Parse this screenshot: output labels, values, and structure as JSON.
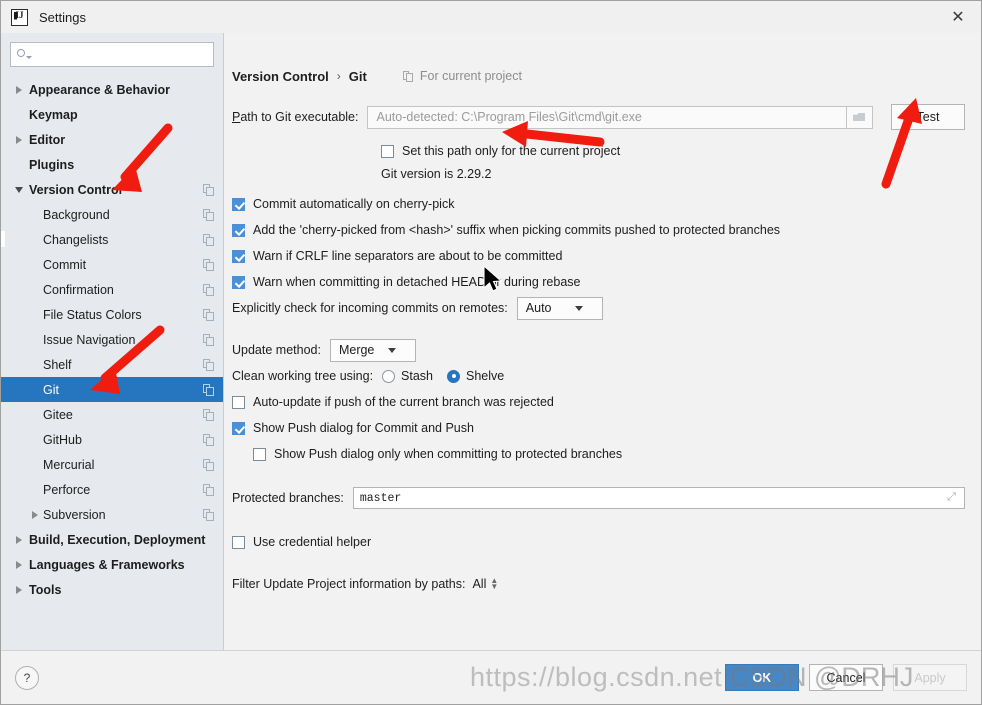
{
  "window": {
    "title": "Settings",
    "app_icon": "intellij-idea-icon",
    "close_icon": "✕"
  },
  "sidebar": {
    "search": {
      "placeholder": "",
      "value": "",
      "icon": "search-icon"
    },
    "items": [
      {
        "label": "Appearance & Behavior",
        "level": 0,
        "arrow": "right",
        "bold": true,
        "copy": false,
        "selected": false
      },
      {
        "label": "Keymap",
        "level": 0,
        "arrow": "none",
        "bold": true,
        "copy": false,
        "selected": false
      },
      {
        "label": "Editor",
        "level": 0,
        "arrow": "right",
        "bold": true,
        "copy": false,
        "selected": false
      },
      {
        "label": "Plugins",
        "level": 0,
        "arrow": "none",
        "bold": true,
        "copy": false,
        "selected": false
      },
      {
        "label": "Version Control",
        "level": 0,
        "arrow": "down",
        "bold": true,
        "copy": true,
        "selected": false
      },
      {
        "label": "Background",
        "level": 1,
        "arrow": "none",
        "bold": false,
        "copy": true,
        "selected": false
      },
      {
        "label": "Changelists",
        "level": 1,
        "arrow": "none",
        "bold": false,
        "copy": true,
        "selected": false
      },
      {
        "label": "Commit",
        "level": 1,
        "arrow": "none",
        "bold": false,
        "copy": true,
        "selected": false
      },
      {
        "label": "Confirmation",
        "level": 1,
        "arrow": "none",
        "bold": false,
        "copy": true,
        "selected": false
      },
      {
        "label": "File Status Colors",
        "level": 1,
        "arrow": "none",
        "bold": false,
        "copy": true,
        "selected": false
      },
      {
        "label": "Issue Navigation",
        "level": 1,
        "arrow": "none",
        "bold": false,
        "copy": true,
        "selected": false
      },
      {
        "label": "Shelf",
        "level": 1,
        "arrow": "none",
        "bold": false,
        "copy": true,
        "selected": false
      },
      {
        "label": "Git",
        "level": 1,
        "arrow": "none",
        "bold": false,
        "copy": true,
        "selected": true
      },
      {
        "label": "Gitee",
        "level": 1,
        "arrow": "none",
        "bold": false,
        "copy": true,
        "selected": false
      },
      {
        "label": "GitHub",
        "level": 1,
        "arrow": "none",
        "bold": false,
        "copy": true,
        "selected": false
      },
      {
        "label": "Mercurial",
        "level": 1,
        "arrow": "none",
        "bold": false,
        "copy": true,
        "selected": false
      },
      {
        "label": "Perforce",
        "level": 1,
        "arrow": "none",
        "bold": false,
        "copy": true,
        "selected": false
      },
      {
        "label": "Subversion",
        "level": 1,
        "arrow": "right",
        "bold": false,
        "copy": true,
        "selected": false
      },
      {
        "label": "Build, Execution, Deployment",
        "level": 0,
        "arrow": "right",
        "bold": true,
        "copy": false,
        "selected": false
      },
      {
        "label": "Languages & Frameworks",
        "level": 0,
        "arrow": "right",
        "bold": true,
        "copy": false,
        "selected": false
      },
      {
        "label": "Tools",
        "level": 0,
        "arrow": "right",
        "bold": true,
        "copy": false,
        "selected": false
      }
    ]
  },
  "main": {
    "breadcrumb": {
      "root": "Version Control",
      "separator": "›",
      "leaf": "Git"
    },
    "for_current_project": "For current project",
    "path_label": "Path to Git executable:",
    "path_placeholder": "Auto-detected: C:\\Program Files\\Git\\cmd\\git.exe",
    "path_value": "",
    "folder_icon": "folder-icon",
    "test_button": "Test",
    "set_path_checkbox": {
      "label": "Set this path only for the current project",
      "checked": false
    },
    "git_version": "Git version is 2.29.2",
    "checkboxes": [
      {
        "label": "Commit automatically on cherry-pick",
        "checked": true
      },
      {
        "label": "Add the 'cherry-picked from <hash>' suffix when picking commits pushed to protected branches",
        "checked": true
      },
      {
        "label": "Warn if CRLF line separators are about to be committed",
        "checked": true
      },
      {
        "label": "Warn when committing in detached HEAD or during rebase",
        "checked": true
      }
    ],
    "incoming_label": "Explicitly check for incoming commits on remotes:",
    "incoming_value": "Auto",
    "update_method_label": "Update method:",
    "update_method_value": "Merge",
    "clean_tree_label": "Clean working tree using:",
    "clean_tree_options": [
      {
        "label": "Stash",
        "selected": false
      },
      {
        "label": "Shelve",
        "selected": true
      }
    ],
    "auto_update_checkbox": {
      "label": "Auto-update if push of the current branch was rejected",
      "checked": false
    },
    "show_push_checkbox": {
      "label": "Show Push dialog for Commit and Push",
      "checked": true
    },
    "show_push_protected_checkbox": {
      "label": "Show Push dialog only when committing to protected branches",
      "checked": false
    },
    "protected_branches_label": "Protected branches:",
    "protected_branches_value": "master",
    "expand_icon": "expand-icon",
    "credential_checkbox": {
      "label": "Use credential helper",
      "checked": false
    },
    "filter_label": "Filter Update Project information by paths:",
    "filter_value": "All"
  },
  "footer": {
    "help_label": "?",
    "ok_label": "OK",
    "cancel_label": "Cancel",
    "apply_label": "Apply"
  },
  "watermark": {
    "url": "https://blog.csdn.net",
    "tag": "CSDN @DRHJ"
  },
  "colors": {
    "selection_blue": "#2675bf",
    "checkbox_blue": "#4a90d9",
    "primary_button": "#4887c4",
    "sidebar_bg": "#e6eaee",
    "panel_bg": "#f2f2f2",
    "annotation_red": "#f01c10"
  }
}
